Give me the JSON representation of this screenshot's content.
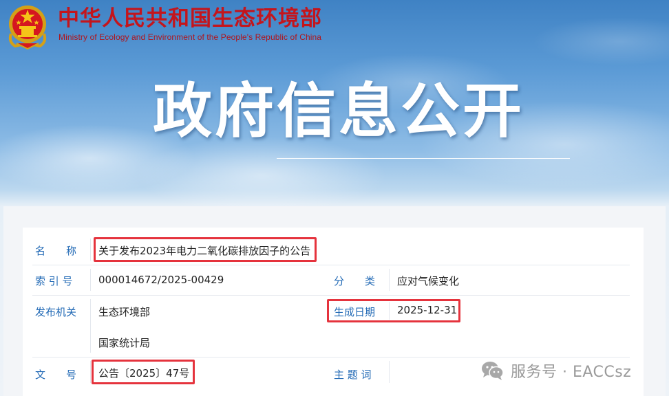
{
  "header": {
    "title": "中华人民共和国生态环境部",
    "subtitle": "Ministry of Ecology and Environment of the People's Republic of China"
  },
  "banner": {
    "title": "政府信息公开"
  },
  "info": {
    "name_label": "名　　称",
    "name_value": "关于发布2023年电力二氧化碳排放因子的公告",
    "index_label": "索 引 号",
    "index_value": "000014672/2025-00429",
    "category_label": "分　　类",
    "category_value": "应对气候变化",
    "issuer_label": "发布机关",
    "issuer_values": [
      "生态环境部",
      "国家统计局"
    ],
    "date_label": "生成日期",
    "date_value": "2025-12-31",
    "doc_no_label": "文　　号",
    "doc_no_value": "公告〔2025〕47号",
    "subject_label": "主 题 词",
    "subject_value": ""
  },
  "watermark": {
    "text": "服务号 · EACCsz",
    "icon": "wechat-icon"
  },
  "colors": {
    "brand_red": "#c4151c",
    "label_blue": "#2169b5",
    "highlight_red": "#e5333d"
  }
}
